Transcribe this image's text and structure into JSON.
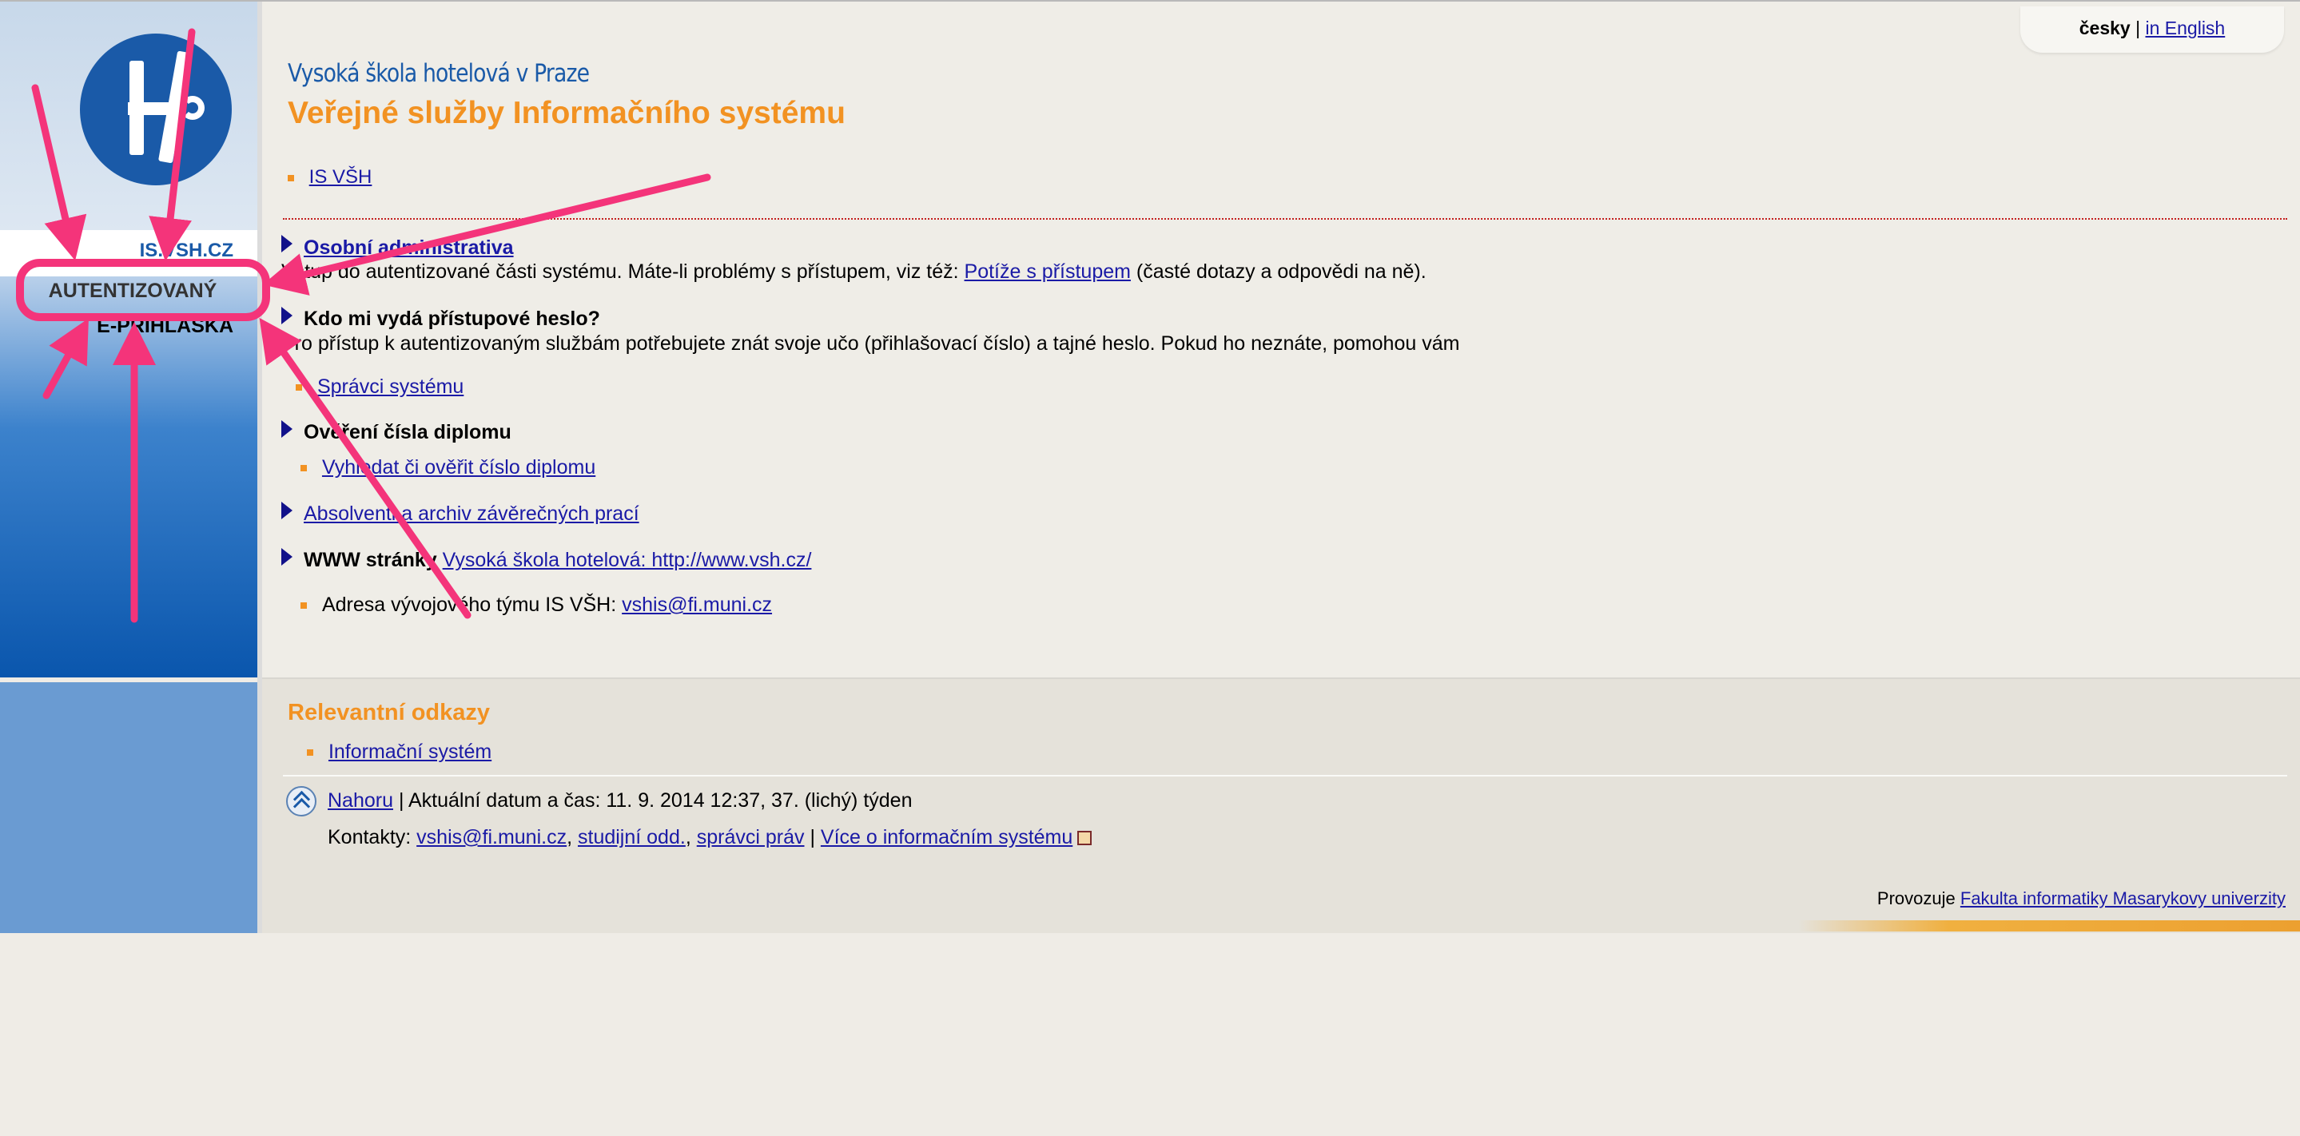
{
  "sidebar": {
    "logo_icon": "hotel-school-logo",
    "is_link": "IS.VSH.CZ",
    "nav_auth": "AUTENTIZOVANÝ",
    "nav_eprihlaska": "E-PŘIHLÁŠKA"
  },
  "language": {
    "current": "česky",
    "separator": "|",
    "other": "in English"
  },
  "header": {
    "school_name": "Vysoká škola hotelová v Praze",
    "page_title": "Veřejné služby Informačního systému",
    "crumb": "IS VŠH"
  },
  "sections": {
    "s1": {
      "title": "Osobní administrativa",
      "text_before": "Vstup do autentizované části systému. Máte-li problémy s přístupem, viz též: ",
      "link": "Potíže s přístupem",
      "text_after": " (časté dotazy a odpovědi na ně)."
    },
    "s2": {
      "title": "Kdo mi vydá přístupové heslo?",
      "text": "Pro přístup k autentizovaným službám potřebujete znát svoje učo (přihlašovací číslo) a tajné heslo. Pokud ho neznáte, pomohou vám",
      "link": "Správci systému"
    },
    "s3": {
      "title": "Ověření čísla diplomu",
      "link": "Vyhledat či ověřit číslo diplomu"
    },
    "s4": {
      "link": "Absolventi a archiv závěrečných prací"
    },
    "s5": {
      "label": "WWW stránky",
      "link": "Vysoká škola hotelová: http://www.vsh.cz/"
    },
    "s6": {
      "text": "Adresa vývojového týmu IS VŠH: ",
      "link": "vshis@fi.muni.cz"
    }
  },
  "footer": {
    "relevant_title": "Relevantní odkazy",
    "relevant_link": "Informační systém",
    "up_link": "Nahoru",
    "datetime_text": " | Aktuální datum a čas: 11. 9. 2014 12:37, 37. (lichý) týden",
    "contacts_label": "Kontakty: ",
    "contact_email": "vshis@fi.muni.cz",
    "contact_study": "studijní odd.",
    "contact_rights": "správci práv",
    "more_info": "Více o informačním systému",
    "operator_text": "Provozuje ",
    "operator_link": "Fakulta informatiky Masarykovy univerzity"
  },
  "annotations": {
    "color": "#f4347a"
  }
}
